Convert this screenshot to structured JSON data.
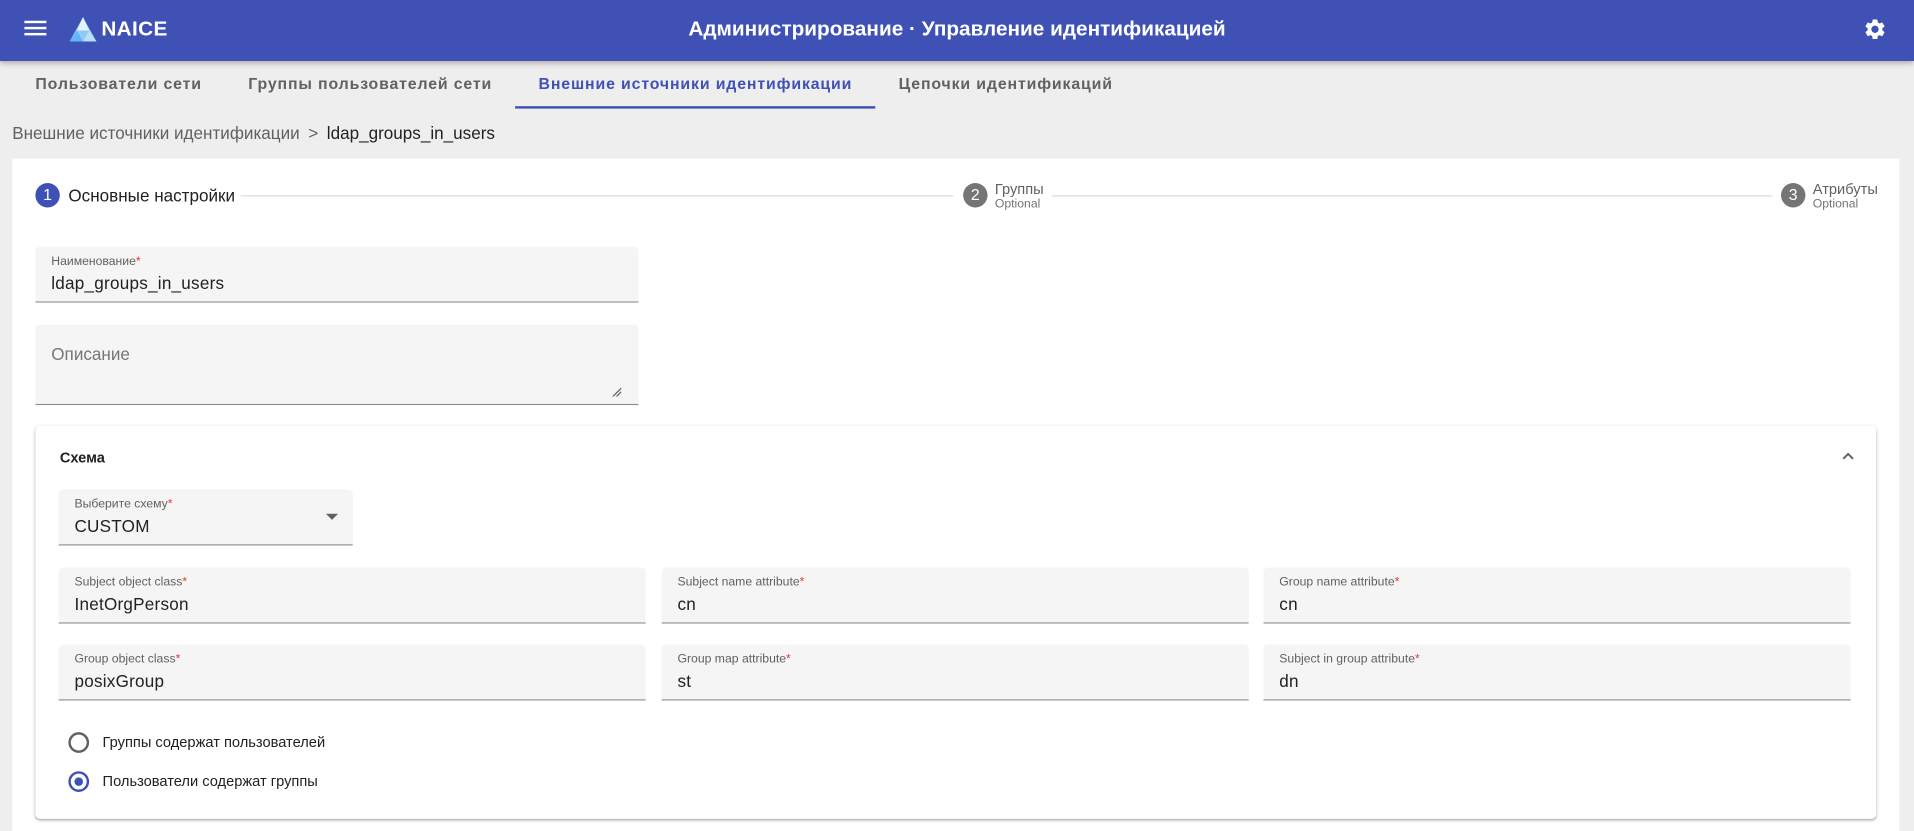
{
  "app": {
    "brand": "NAICE",
    "title": "Администрирование · Управление идентификацией"
  },
  "tabs": [
    {
      "label": "Пользователи сети"
    },
    {
      "label": "Группы пользователей сети"
    },
    {
      "label": "Внешние источники идентификации"
    },
    {
      "label": "Цепочки идентификаций"
    }
  ],
  "active_tab_index": 2,
  "breadcrumb": {
    "parent": "Внешние источники идентификации",
    "separator": ">",
    "current": "ldap_groups_in_users"
  },
  "stepper": {
    "steps": [
      {
        "number": "1",
        "label": "Основные настройки",
        "optional": ""
      },
      {
        "number": "2",
        "label": "Группы",
        "optional": "Optional"
      },
      {
        "number": "3",
        "label": "Атрибуты",
        "optional": "Optional"
      }
    ]
  },
  "form": {
    "name": {
      "label": "Наименование",
      "required_mark": "*",
      "value": "ldap_groups_in_users"
    },
    "description": {
      "placeholder": "Описание"
    }
  },
  "schema_panel": {
    "title": "Схема",
    "schema_select": {
      "label": "Выберите схему",
      "required_mark": "*",
      "value": "CUSTOM"
    },
    "fields": {
      "subject_object_class": {
        "label": "Subject object class",
        "required_mark": "*",
        "value": "InetOrgPerson"
      },
      "subject_name_attribute": {
        "label": "Subject name attribute",
        "required_mark": "*",
        "value": "cn"
      },
      "group_name_attribute": {
        "label": "Group name attribute",
        "required_mark": "*",
        "value": "cn"
      },
      "group_object_class": {
        "label": "Group object class",
        "required_mark": "*",
        "value": "posixGroup"
      },
      "group_map_attribute": {
        "label": "Group map attribute",
        "required_mark": "*",
        "value": "st"
      },
      "subject_in_group_attribute": {
        "label": "Subject in group attribute",
        "required_mark": "*",
        "value": "dn"
      }
    },
    "radio_options": [
      {
        "label": "Группы содержат пользователей",
        "checked": false
      },
      {
        "label": "Пользователи содержат группы",
        "checked": true
      }
    ]
  },
  "colors": {
    "primary": "#3f51b5",
    "required": "#e53935",
    "background": "#eeeeee"
  }
}
